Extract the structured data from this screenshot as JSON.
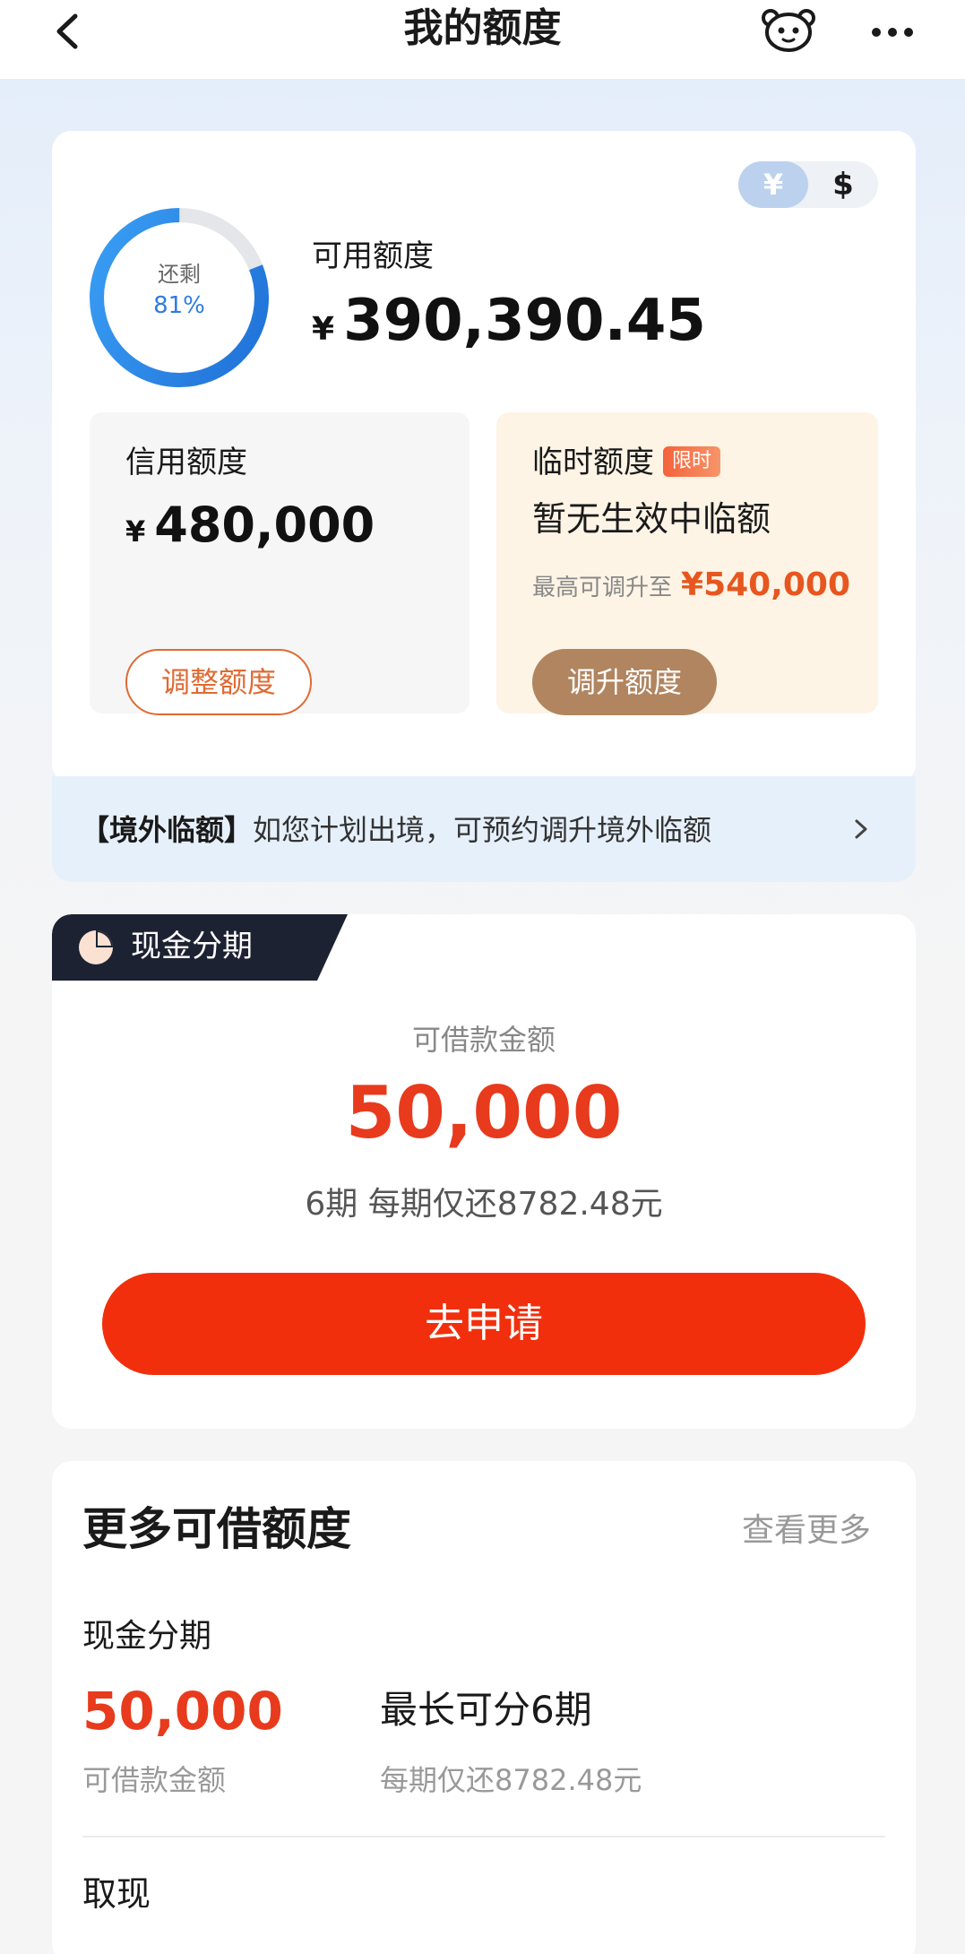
{
  "nav": {
    "title": "我的额度"
  },
  "currency": {
    "rmb": "¥",
    "usd": "$"
  },
  "quota": {
    "ring_label": "还剩",
    "ring_percent": "81%",
    "remaining_fraction": 0.81,
    "available_label": "可用额度",
    "available_yen": "¥",
    "available_amount": "390,390.45"
  },
  "credit": {
    "title": "信用额度",
    "yen": "¥",
    "amount": "480,000",
    "button": "调整额度"
  },
  "temporary": {
    "title": "临时额度",
    "badge": "限时",
    "status": "暂无生效中临额",
    "max_label": "最高可调升至",
    "max_value": "¥540,000",
    "button": "调升额度"
  },
  "overseas": {
    "bracket": "【境外临额】",
    "text": "如您计划出境，可预约调升境外临额"
  },
  "cash_installment": {
    "tag": "现金分期",
    "borrow_label": "可借款金额",
    "borrow_amount": "50,000",
    "terms": "6期  每期仅还8782.48元",
    "apply_button": "去申请"
  },
  "more": {
    "title": "更多可借额度",
    "link": "查看更多",
    "item1_title": "现金分期",
    "item1_amount": "50,000",
    "item1_amount_label": "可借款金额",
    "item1_periods": "最长可分6期",
    "item1_periods_sub": "每期仅还8782.48元",
    "item2_title": "取现"
  },
  "colors": {
    "accent_red": "#f22f0c",
    "amount_red": "#e83a1c",
    "ring_blue": "#2d7ce0",
    "gold_button": "#b08560"
  }
}
